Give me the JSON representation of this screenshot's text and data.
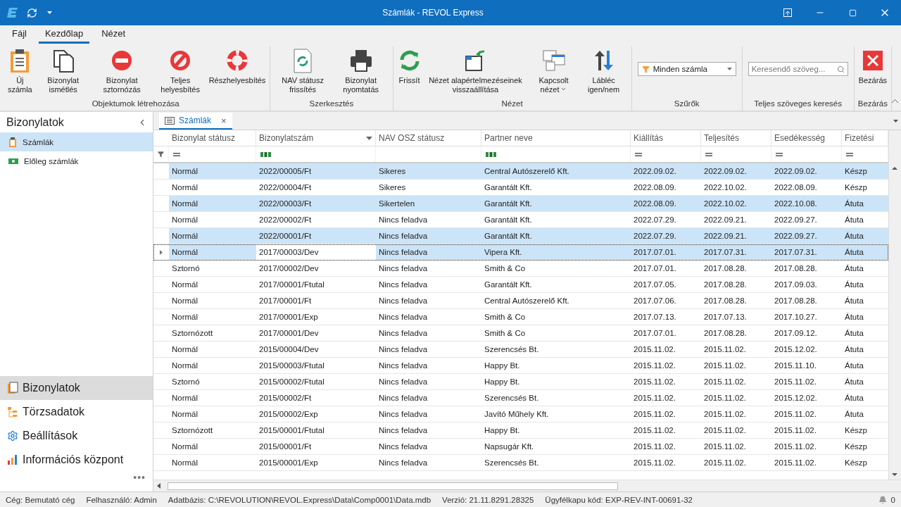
{
  "window": {
    "title": "Számlák - REVOL Express"
  },
  "menu_tabs": [
    {
      "label": "Fájl",
      "selected": false
    },
    {
      "label": "Kezdőlap",
      "selected": true
    },
    {
      "label": "Nézet",
      "selected": false
    }
  ],
  "ribbon_groups": [
    {
      "label": "Objektumok létrehozása",
      "items": [
        {
          "kind": "button",
          "label": "Új számla"
        },
        {
          "kind": "button",
          "label": "Bizonylat ismétlés"
        },
        {
          "kind": "button",
          "label": "Bizonylat sztornózás"
        },
        {
          "kind": "button",
          "label": "Teljes helyesbítés"
        },
        {
          "kind": "button",
          "label": "Részhelyesbítés"
        }
      ]
    },
    {
      "label": "Szerkesztés",
      "items": [
        {
          "kind": "button",
          "label": "NAV státusz frissítés"
        },
        {
          "kind": "button",
          "label": "Bizonylat nyomtatás"
        }
      ]
    },
    {
      "label": "Nézet",
      "items": [
        {
          "kind": "button",
          "label": "Frissít"
        },
        {
          "kind": "button",
          "label": "Nézet alapértelmezéseinek visszaállítása"
        },
        {
          "kind": "button",
          "label": "Kapcsolt nézet",
          "dropdown": true
        },
        {
          "kind": "button",
          "label": "Lábléc igen/nem"
        }
      ]
    },
    {
      "label": "Szűrők",
      "items": [
        {
          "kind": "combo",
          "value": "Minden számla"
        }
      ]
    },
    {
      "label": "Teljes szöveges keresés",
      "items": [
        {
          "kind": "search",
          "placeholder": "Keresendő szöveg..."
        }
      ]
    },
    {
      "label": "Bezárás",
      "items": [
        {
          "kind": "button",
          "label": "Bezárás"
        }
      ]
    }
  ],
  "sidebar": {
    "title": "Bizonylatok",
    "items": [
      {
        "label": "Számlák",
        "selected": true
      },
      {
        "label": "Előleg számlák",
        "selected": false
      }
    ],
    "nav": [
      {
        "label": "Bizonylatok",
        "selected": true
      },
      {
        "label": "Törzsadatok",
        "selected": false
      },
      {
        "label": "Beállítások",
        "selected": false
      },
      {
        "label": "Információs központ",
        "selected": false
      }
    ],
    "more": "•••"
  },
  "doc_tab": {
    "label": "Számlák",
    "close": "×"
  },
  "table": {
    "columns": [
      {
        "label": "Bizonylat státusz",
        "kind": "equals",
        "sorted": false
      },
      {
        "label": "Bizonylatszám",
        "kind": "text",
        "sorted": true
      },
      {
        "label": "NAV OSZ státusz",
        "kind": "none",
        "sorted": false
      },
      {
        "label": "Partner neve",
        "kind": "text",
        "sorted": false
      },
      {
        "label": "Kiállítás",
        "kind": "equals",
        "sorted": false
      },
      {
        "label": "Teljesítés",
        "kind": "equals",
        "sorted": false
      },
      {
        "label": "Esedékesség",
        "kind": "equals",
        "sorted": false
      },
      {
        "label": "Fizetési",
        "kind": "equals",
        "sorted": false
      }
    ],
    "rows": [
      {
        "cells": [
          "Normál",
          "2022/00005/Ft",
          "Sikeres",
          "Central Autószerelő Kft.",
          "2022.09.02.",
          "2022.09.02.",
          "2022.09.02.",
          "Készp"
        ],
        "selected": true,
        "focused": false
      },
      {
        "cells": [
          "Normál",
          "2022/00004/Ft",
          "Sikeres",
          "Garantált Kft.",
          "2022.08.09.",
          "2022.10.02.",
          "2022.08.09.",
          "Készp"
        ],
        "selected": false,
        "focused": false
      },
      {
        "cells": [
          "Normál",
          "2022/00003/Ft",
          "Sikertelen",
          "Garantált Kft.",
          "2022.08.09.",
          "2022.10.02.",
          "2022.10.08.",
          "Átuta"
        ],
        "selected": true,
        "focused": false
      },
      {
        "cells": [
          "Normál",
          "2022/00002/Ft",
          "Nincs feladva",
          "Garantált Kft.",
          "2022.07.29.",
          "2022.09.21.",
          "2022.09.27.",
          "Átuta"
        ],
        "selected": false,
        "focused": false
      },
      {
        "cells": [
          "Normál",
          "2022/00001/Ft",
          "Nincs feladva",
          "Garantált Kft.",
          "2022.07.29.",
          "2022.09.21.",
          "2022.09.27.",
          "Átuta"
        ],
        "selected": true,
        "focused": false
      },
      {
        "cells": [
          "Normál",
          "2017/00003/Dev",
          "Nincs feladva",
          "Vipera Kft.",
          "2017.07.01.",
          "2017.07.31.",
          "2017.07.31.",
          "Átuta"
        ],
        "selected": true,
        "focused": true
      },
      {
        "cells": [
          "Sztornó",
          "2017/00002/Dev",
          "Nincs feladva",
          "Smith & Co",
          "2017.07.01.",
          "2017.08.28.",
          "2017.08.28.",
          "Átuta"
        ],
        "selected": false,
        "focused": false
      },
      {
        "cells": [
          "Normál",
          "2017/00001/Ftutal",
          "Nincs feladva",
          "Garantált Kft.",
          "2017.07.05.",
          "2017.08.28.",
          "2017.09.03.",
          "Átuta"
        ],
        "selected": false,
        "focused": false
      },
      {
        "cells": [
          "Normál",
          "2017/00001/Ft",
          "Nincs feladva",
          "Central Autószerelő Kft.",
          "2017.07.06.",
          "2017.08.28.",
          "2017.08.28.",
          "Átuta"
        ],
        "selected": false,
        "focused": false
      },
      {
        "cells": [
          "Normál",
          "2017/00001/Exp",
          "Nincs feladva",
          "Smith & Co",
          "2017.07.13.",
          "2017.07.13.",
          "2017.10.27.",
          "Átuta"
        ],
        "selected": false,
        "focused": false
      },
      {
        "cells": [
          "Sztornózott",
          "2017/00001/Dev",
          "Nincs feladva",
          "Smith & Co",
          "2017.07.01.",
          "2017.08.28.",
          "2017.09.12.",
          "Átuta"
        ],
        "selected": false,
        "focused": false
      },
      {
        "cells": [
          "Normál",
          "2015/00004/Dev",
          "Nincs feladva",
          "Szerencsés Bt.",
          "2015.11.02.",
          "2015.11.02.",
          "2015.12.02.",
          "Átuta"
        ],
        "selected": false,
        "focused": false
      },
      {
        "cells": [
          "Normál",
          "2015/00003/Ftutal",
          "Nincs feladva",
          "Happy Bt.",
          "2015.11.02.",
          "2015.11.02.",
          "2015.11.10.",
          "Átuta"
        ],
        "selected": false,
        "focused": false
      },
      {
        "cells": [
          "Sztornó",
          "2015/00002/Ftutal",
          "Nincs feladva",
          "Happy Bt.",
          "2015.11.02.",
          "2015.11.02.",
          "2015.11.02.",
          "Átuta"
        ],
        "selected": false,
        "focused": false
      },
      {
        "cells": [
          "Normál",
          "2015/00002/Ft",
          "Nincs feladva",
          "Szerencsés Bt.",
          "2015.11.02.",
          "2015.11.02.",
          "2015.12.02.",
          "Átuta"
        ],
        "selected": false,
        "focused": false
      },
      {
        "cells": [
          "Normál",
          "2015/00002/Exp",
          "Nincs feladva",
          "Javító Műhely Kft.",
          "2015.11.02.",
          "2015.11.02.",
          "2015.11.02.",
          "Átuta"
        ],
        "selected": false,
        "focused": false
      },
      {
        "cells": [
          "Sztornózott",
          "2015/00001/Ftutal",
          "Nincs feladva",
          "Happy Bt.",
          "2015.11.02.",
          "2015.11.02.",
          "2015.11.02.",
          "Készp"
        ],
        "selected": false,
        "focused": false
      },
      {
        "cells": [
          "Normál",
          "2015/00001/Ft",
          "Nincs feladva",
          "Napsugár Kft.",
          "2015.11.02.",
          "2015.11.02.",
          "2015.11.02.",
          "Készp"
        ],
        "selected": false,
        "focused": false
      },
      {
        "cells": [
          "Normál",
          "2015/00001/Exp",
          "Nincs feladva",
          "Szerencsés Bt.",
          "2015.11.02.",
          "2015.11.02.",
          "2015.11.02.",
          "Készp"
        ],
        "selected": false,
        "focused": false
      }
    ]
  },
  "status_bar": {
    "items": [
      "Cég: Bemutató cég",
      "Felhasználó: Admin",
      "Adatbázis: C:\\REVOLUTION\\REVOL.Express\\Data\\Comp0001\\Data.mdb",
      "Verzió: 21.11.8291.28325",
      "Ügyfélkapu kód: EXP-REV-INT-00691-32"
    ],
    "notifications": "0"
  }
}
